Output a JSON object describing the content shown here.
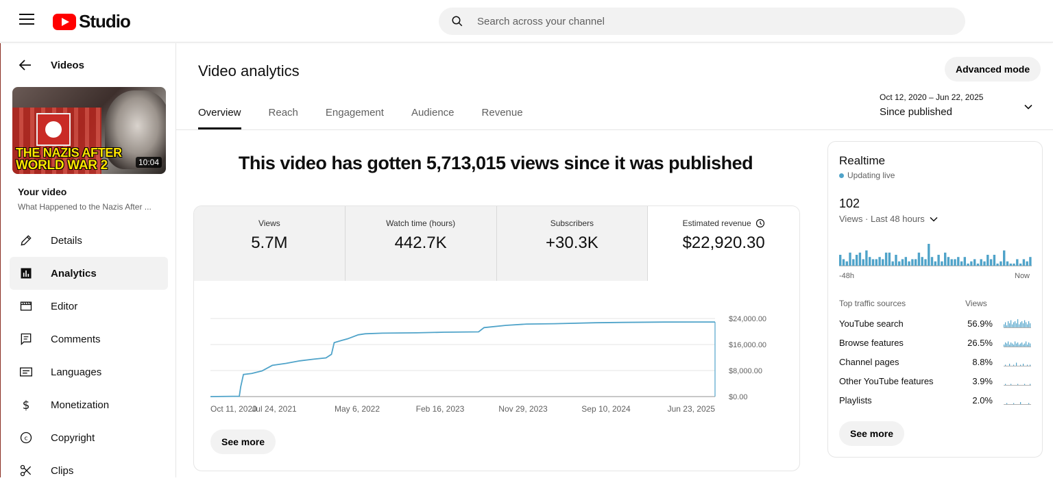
{
  "topbar": {
    "logo_text": "Studio",
    "search_placeholder": "Search across your channel",
    "brand_color": "#ff0000"
  },
  "sidebar": {
    "back_label": "Videos",
    "thumbnail": {
      "title_line1": "THE NAZIS AFTER",
      "title_line2": "WORLD WAR 2",
      "duration": "10:04"
    },
    "your_video_label": "Your video",
    "video_title": "What Happened to the Nazis After ...",
    "items": [
      {
        "label": "Details",
        "icon": "pencil-icon"
      },
      {
        "label": "Analytics",
        "icon": "analytics-icon"
      },
      {
        "label": "Editor",
        "icon": "editor-icon"
      },
      {
        "label": "Comments",
        "icon": "comments-icon"
      },
      {
        "label": "Languages",
        "icon": "languages-icon"
      },
      {
        "label": "Monetization",
        "icon": "dollar-icon"
      },
      {
        "label": "Copyright",
        "icon": "copyright-icon"
      },
      {
        "label": "Clips",
        "icon": "scissors-icon"
      }
    ],
    "active_item": "Analytics"
  },
  "main": {
    "title": "Video analytics",
    "advanced_mode_label": "Advanced mode",
    "tabs": [
      "Overview",
      "Reach",
      "Engagement",
      "Audience",
      "Revenue"
    ],
    "active_tab": "Overview",
    "date_range": {
      "range": "Oct 12, 2020 – Jun 22, 2025",
      "label": "Since published"
    },
    "headline": "This video has gotten 5,713,015 views since it was published",
    "metrics": [
      {
        "label": "Views",
        "value": "5.7M"
      },
      {
        "label": "Watch time (hours)",
        "value": "442.7K"
      },
      {
        "label": "Subscribers",
        "value": "+30.3K"
      },
      {
        "label": "Estimated revenue",
        "value": "$22,920.30"
      }
    ],
    "active_metric": "Estimated revenue",
    "see_more_label": "See more"
  },
  "chart_data": {
    "type": "line",
    "title": "",
    "series": [
      {
        "values": [
          [
            0,
            0
          ],
          [
            42,
            100
          ],
          [
            44,
            3000
          ],
          [
            48,
            6800
          ],
          [
            60,
            7100
          ],
          [
            75,
            7900
          ],
          [
            90,
            9600
          ],
          [
            110,
            10200
          ],
          [
            130,
            11000
          ],
          [
            150,
            11500
          ],
          [
            168,
            11900
          ],
          [
            176,
            13000
          ],
          [
            180,
            16600
          ],
          [
            190,
            17200
          ],
          [
            200,
            17800
          ],
          [
            215,
            19000
          ],
          [
            225,
            19300
          ],
          [
            250,
            19500
          ],
          [
            300,
            19600
          ],
          [
            340,
            19800
          ],
          [
            390,
            19900
          ],
          [
            398,
            21200
          ],
          [
            430,
            21900
          ],
          [
            460,
            22300
          ],
          [
            500,
            22400
          ],
          [
            560,
            22700
          ],
          [
            600,
            22800
          ],
          [
            660,
            22900
          ],
          [
            734,
            22920
          ]
        ]
      }
    ],
    "x_tick_labels": [
      "Oct 11, 2020",
      "Jul 24, 2021",
      "May 6, 2022",
      "Feb 16, 2023",
      "Nov 29, 2023",
      "Sep 10, 2024",
      "Jun 23, 2025"
    ],
    "y_tick_labels": [
      "$24,000.00",
      "$16,000.00",
      "$8,000.00",
      "$0.00"
    ],
    "ylim": [
      0,
      24000
    ],
    "y_axis_side": "right",
    "grid": true,
    "line_color": "#4fa3c9"
  },
  "realtime": {
    "title": "Realtime",
    "status": "Updating live",
    "count": "102",
    "subtitle": "Views · Last 48 hours",
    "bar_values": [
      5,
      3,
      2,
      6,
      3,
      5,
      6,
      3,
      7,
      4,
      3,
      3,
      4,
      3,
      6,
      6,
      2,
      5,
      2,
      3,
      4,
      2,
      3,
      3,
      6,
      4,
      3,
      10,
      4,
      2,
      5,
      2,
      6,
      4,
      3,
      3,
      4,
      2,
      4,
      1,
      2,
      3,
      1,
      3,
      2,
      5,
      3,
      5,
      1,
      2,
      7,
      2,
      1,
      1,
      3,
      1,
      3,
      2,
      4
    ],
    "bar_color": "#4fa3c9",
    "axis_left": "-48h",
    "axis_right": "Now",
    "traffic_header": "Top traffic sources",
    "traffic_views_header": "Views",
    "traffic_sources": [
      {
        "name": "YouTube search",
        "pct": "56.9%"
      },
      {
        "name": "Browse features",
        "pct": "26.5%"
      },
      {
        "name": "Channel pages",
        "pct": "8.8%"
      },
      {
        "name": "Other YouTube features",
        "pct": "3.9%"
      },
      {
        "name": "Playlists",
        "pct": "2.0%"
      }
    ],
    "see_more_label": "See more"
  }
}
